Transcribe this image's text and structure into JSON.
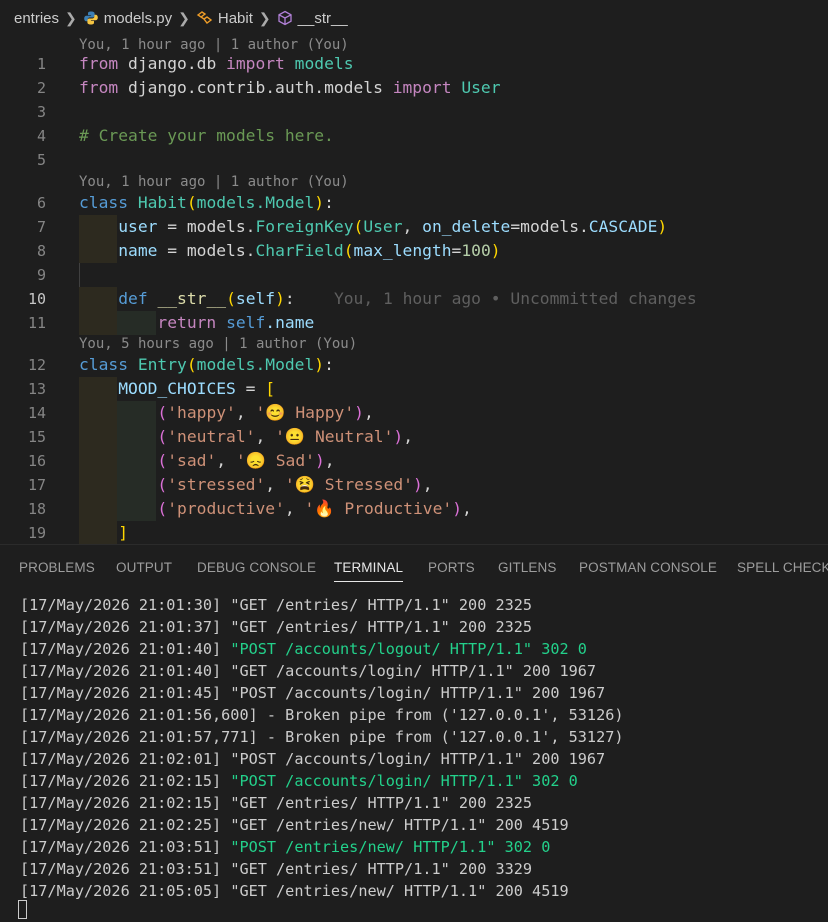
{
  "breadcrumb": {
    "items": [
      "entries",
      "models.py",
      "Habit",
      "__str__"
    ]
  },
  "editor": {
    "lens": [
      "You, 1 hour ago | 1 author (You)",
      "You, 1 hour ago | 1 author (You)",
      "You, 5 hours ago | 1 author (You)"
    ],
    "blame_inline": "You, 1 hour ago • Uncommitted changes",
    "line_numbers": [
      "1",
      "2",
      "3",
      "4",
      "5",
      "6",
      "7",
      "8",
      "9",
      "10",
      "11",
      "12",
      "13",
      "14",
      "15",
      "16",
      "17",
      "18",
      "19"
    ],
    "active_line": "10"
  },
  "panel": {
    "tabs": [
      "PROBLEMS",
      "OUTPUT",
      "DEBUG CONSOLE",
      "TERMINAL",
      "PORTS",
      "GITLENS",
      "POSTMAN CONSOLE",
      "SPELL CHECKER"
    ],
    "active_tab": "TERMINAL",
    "terminal_lines": [
      {
        "ts": "[17/May/2026 21:01:30]",
        "msg": " \"GET /entries/ HTTP/1.1\" 200 2325",
        "color": "#cccccc"
      },
      {
        "ts": "[17/May/2026 21:01:37]",
        "msg": " \"GET /entries/ HTTP/1.1\" 200 2325",
        "color": "#cccccc"
      },
      {
        "ts": "[17/May/2026 21:01:40]",
        "msg": " \"POST /accounts/logout/ HTTP/1.1\" 302 0",
        "color": "#23d18b"
      },
      {
        "ts": "[17/May/2026 21:01:40]",
        "msg": " \"GET /accounts/login/ HTTP/1.1\" 200 1967",
        "color": "#cccccc"
      },
      {
        "ts": "[17/May/2026 21:01:45]",
        "msg": " \"POST /accounts/login/ HTTP/1.1\" 200 1967",
        "color": "#cccccc"
      },
      {
        "ts": "[17/May/2026 21:01:56,600]",
        "msg": " - Broken pipe from ('127.0.0.1', 53126)",
        "color": "#cccccc"
      },
      {
        "ts": "[17/May/2026 21:01:57,771]",
        "msg": " - Broken pipe from ('127.0.0.1', 53127)",
        "color": "#cccccc"
      },
      {
        "ts": "[17/May/2026 21:02:01]",
        "msg": " \"POST /accounts/login/ HTTP/1.1\" 200 1967",
        "color": "#cccccc"
      },
      {
        "ts": "[17/May/2026 21:02:15]",
        "msg": " \"POST /accounts/login/ HTTP/1.1\" 302 0",
        "color": "#23d18b"
      },
      {
        "ts": "[17/May/2026 21:02:15]",
        "msg": " \"GET /entries/ HTTP/1.1\" 200 2325",
        "color": "#cccccc"
      },
      {
        "ts": "[17/May/2026 21:02:25]",
        "msg": " \"GET /entries/new/ HTTP/1.1\" 200 4519",
        "color": "#cccccc"
      },
      {
        "ts": "[17/May/2026 21:03:51]",
        "msg": " \"POST /entries/new/ HTTP/1.1\" 302 0",
        "color": "#23d18b"
      },
      {
        "ts": "[17/May/2026 21:03:51]",
        "msg": " \"GET /entries/ HTTP/1.1\" 200 3329",
        "color": "#cccccc"
      },
      {
        "ts": "[17/May/2026 21:05:05]",
        "msg": " \"GET /entries/new/ HTTP/1.1\" 200 4519",
        "color": "#cccccc"
      }
    ]
  },
  "code": {
    "l1": {
      "a": "from",
      "b": " django.db ",
      "c": "import",
      "d": " models"
    },
    "l2": {
      "a": "from",
      "b": " django.contrib.auth.models ",
      "c": "import",
      "d": " User"
    },
    "l4": "# Create your models here.",
    "l6": {
      "a": "class",
      "b": "Habit",
      "c": "(",
      "d": "models.Model",
      "e": ")",
      "f": ":"
    },
    "l7": {
      "a": "user",
      "b": " = models.",
      "c": "ForeignKey",
      "d": "(",
      "e": "User",
      "f": ", ",
      "g": "on_delete",
      "h": "=models.",
      "i": "CASCADE",
      "j": ")"
    },
    "l8": {
      "a": "name",
      "b": " = models.",
      "c": "CharField",
      "d": "(",
      "e": "max_length",
      "f": "=",
      "g": "100",
      "h": ")"
    },
    "l10": {
      "a": "def",
      "b": "__str__",
      "c": "(",
      "d": "self",
      "e": ")",
      "f": ":"
    },
    "l11": {
      "a": "return",
      "b": "self",
      "c": ".name"
    },
    "l12": {
      "a": "class",
      "b": "Entry",
      "c": "(",
      "d": "models.Model",
      "e": ")",
      "f": ":"
    },
    "l13": {
      "a": "MOOD_CHOICES",
      "b": " = ",
      "c": "["
    },
    "choices": [
      {
        "k": "'happy'",
        "v": "'😊 Happy'"
      },
      {
        "k": "'neutral'",
        "v": "'😐 Neutral'"
      },
      {
        "k": "'sad'",
        "v": "'😞 Sad'"
      },
      {
        "k": "'stressed'",
        "v": "'😫 Stressed'"
      },
      {
        "k": "'productive'",
        "v": "'🔥 Productive'"
      }
    ],
    "l19": "]"
  },
  "colors": {
    "accent_green": "#23d18b",
    "background": "#1e1e1e"
  },
  "icons": [
    "chevron-right-icon",
    "python-file-icon",
    "class-symbol-icon",
    "method-symbol-icon"
  ]
}
